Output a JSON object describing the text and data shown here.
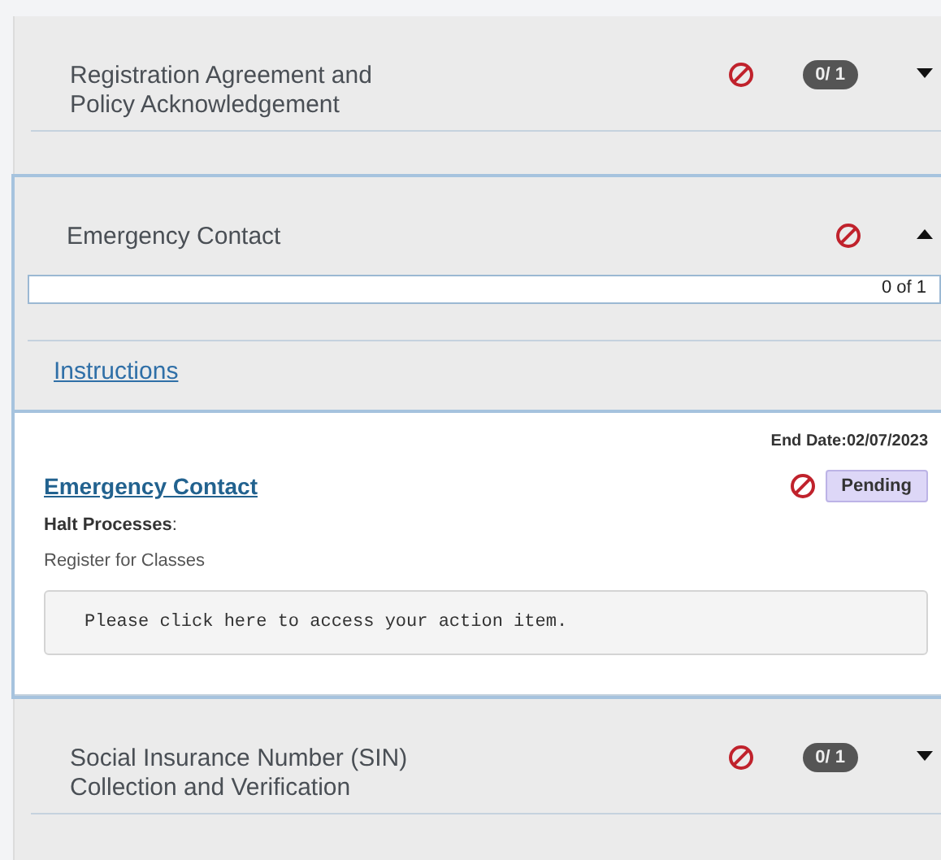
{
  "sections": [
    {
      "title_lines": [
        "Registration Agreement and",
        "Policy Acknowledgement"
      ],
      "blocked": true,
      "badge": "0/ 1",
      "expanded": false
    },
    {
      "title_lines": [
        "Emergency Contact"
      ],
      "blocked": true,
      "expanded": true,
      "progress": {
        "reading": "0 of 1",
        "level": 0
      },
      "instructions": "Instructions",
      "items": [
        {
          "end_date": "End Date:02/07/2023",
          "title": "Emergency Contact",
          "blocked": true,
          "status": "Pending",
          "halt": "**Halt Processes**:",
          "process": "Register for Classes",
          "action": "Please click here to access your action item."
        }
      ]
    },
    {
      "title_lines": [
        "Social Insurance Number (SIN)",
        "Collection and Verification"
      ],
      "blocked": true,
      "badge": "0/ 1",
      "expanded": false
    }
  ]
}
